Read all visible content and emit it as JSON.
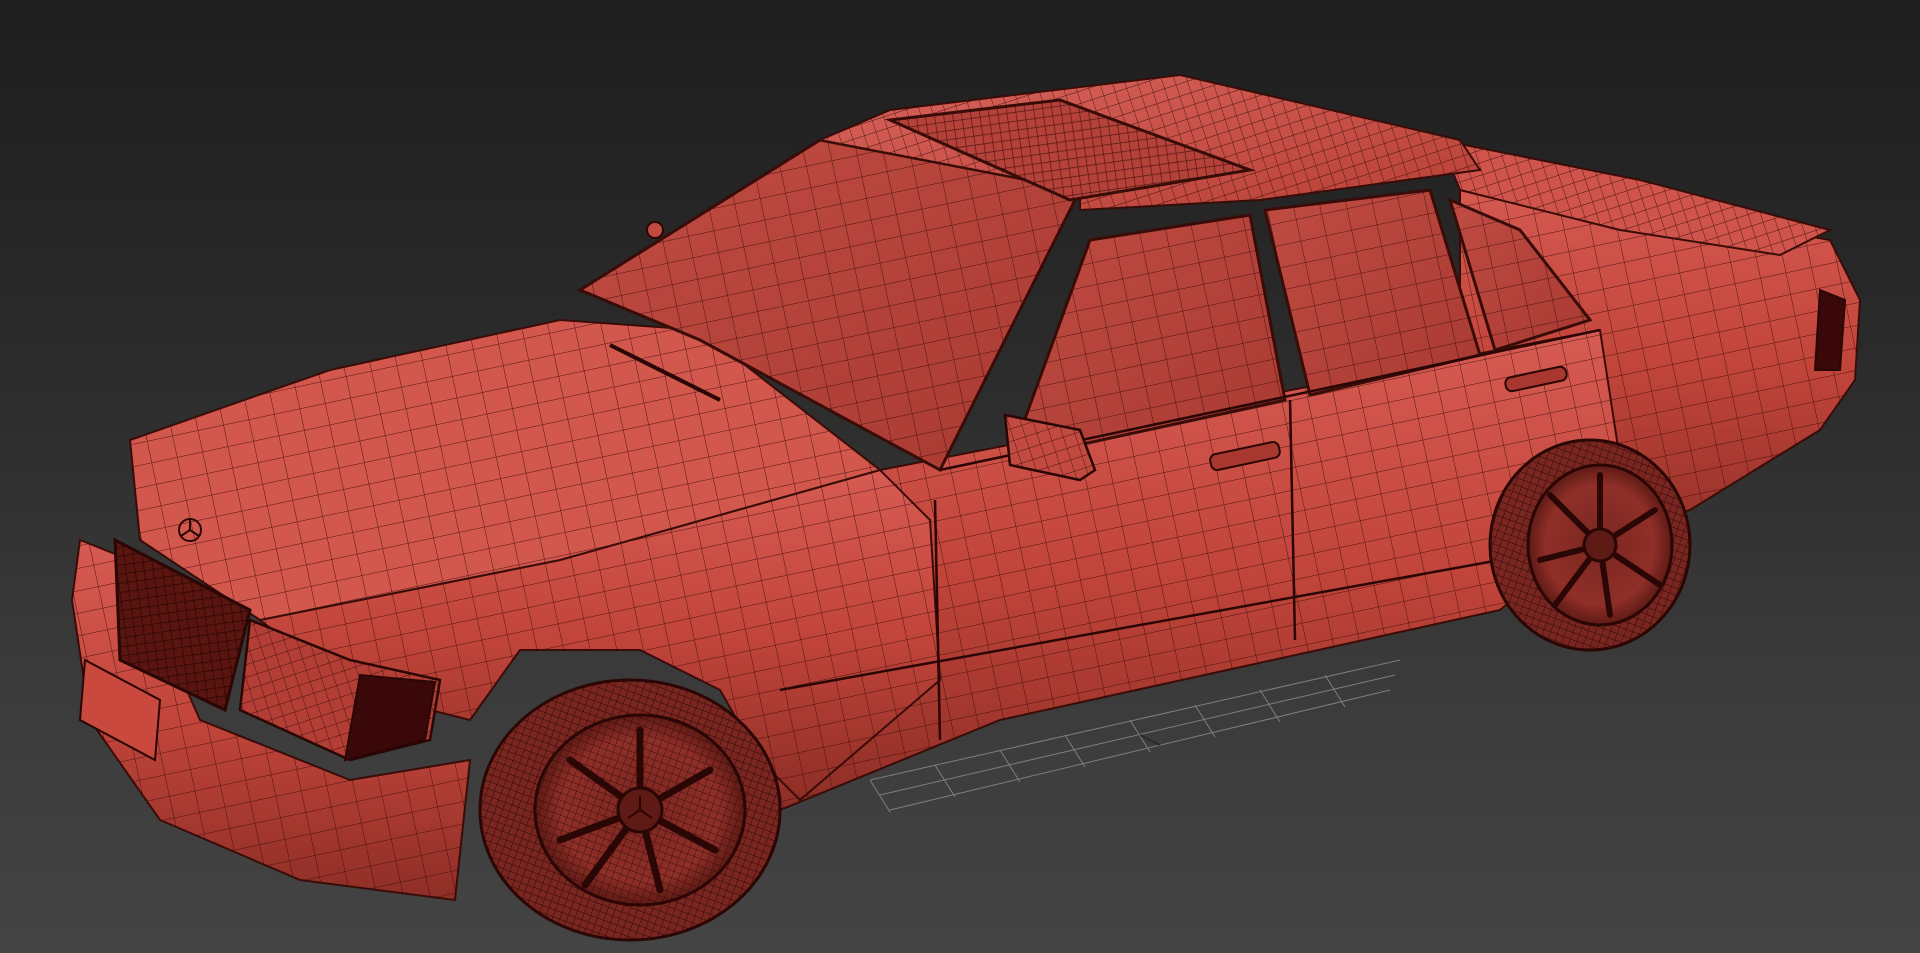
{
  "viewport": {
    "background_top": "#1e1e1e",
    "background_bottom": "#444444"
  },
  "model": {
    "body_color": "#c8473d",
    "body_highlight": "#d9605a",
    "body_shadow": "#8e2e26",
    "wire_color": "#3a0c08",
    "glass_color": "#b0443c",
    "tire_color": "#7a2620",
    "dark_color": "#3a0808"
  },
  "grid": {
    "color": "#9a9a9a"
  }
}
